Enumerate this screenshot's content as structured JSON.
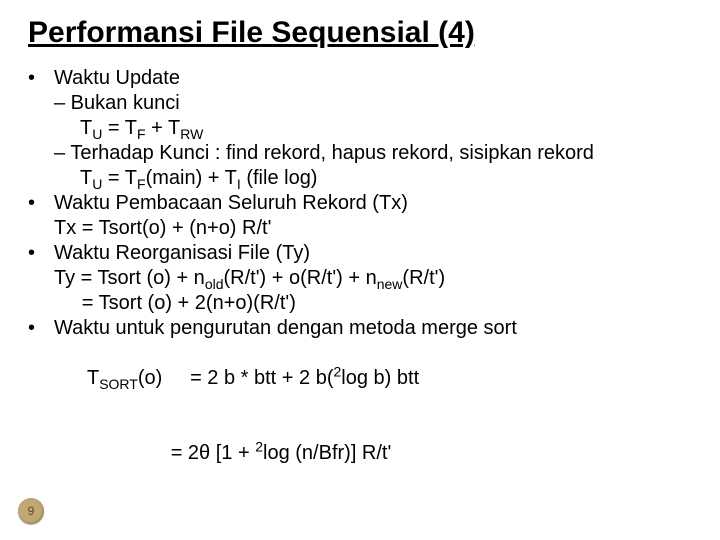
{
  "title": "Performansi File Sequensial (4)",
  "page_number": "9",
  "b1": {
    "head": "Waktu Update",
    "s1": "– Bukan kunci",
    "e1_pre": "T",
    "e1_sub1": "U",
    "e1_mid1": " = T",
    "e1_sub2": "F",
    "e1_mid2": " + T",
    "e1_sub3": "RW",
    "s2": "– Terhadap Kunci : find rekord, hapus rekord, sisipkan rekord",
    "e2_pre": "T",
    "e2_sub1": "U",
    "e2_mid1": " = T",
    "e2_sub2": "F",
    "e2_mid2": "(main) + T",
    "e2_sub3": "I",
    "e2_post": " (file log)"
  },
  "b2": {
    "head": "Waktu Pembacaan Seluruh Rekord (Tx)",
    "eq": "Tx = Tsort(o) + (n+o) R/t'"
  },
  "b3": {
    "head": "Waktu Reorganisasi File (Ty)",
    "eq1_pre": "Ty = Tsort (o) + n",
    "eq1_sub1": "old",
    "eq1_mid1": "(R/t') + o(R/t') + n",
    "eq1_sub2": "new",
    "eq1_post": "(R/t')",
    "eq2": "     = Tsort (o) + 2(n+o)(R/t')"
  },
  "b4": {
    "head": "Waktu untuk pengurutan dengan metoda merge sort",
    "eq1_pre": "T",
    "eq1_sub1": "SORT",
    "eq1_mid1": "(o)     = 2 b * btt + 2 b(",
    "eq1_sup1": "2",
    "eq1_post": "log b) btt",
    "eq2_pre": "               = 2θ [1 + ",
    "eq2_sup1": "2",
    "eq2_post": "log (n/Bfr)] R/t'"
  }
}
